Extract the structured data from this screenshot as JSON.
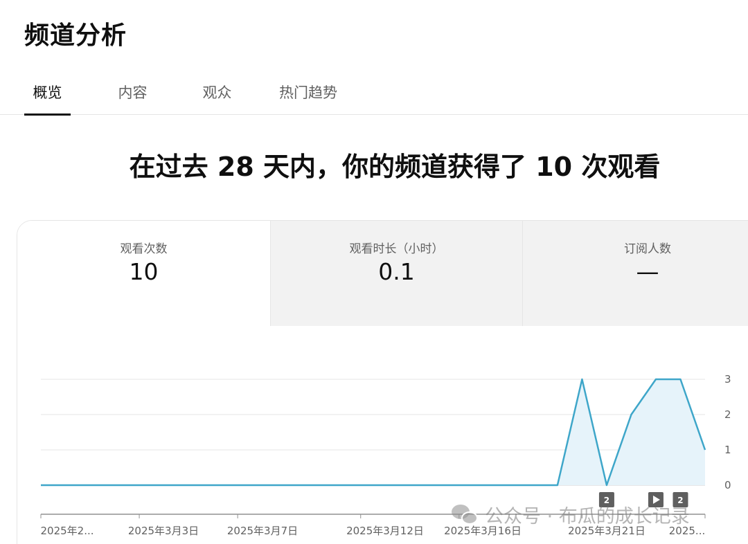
{
  "header": {
    "title": "频道分析"
  },
  "tabs": [
    {
      "label": "概览",
      "active": true
    },
    {
      "label": "内容",
      "active": false
    },
    {
      "label": "观众",
      "active": false
    },
    {
      "label": "热门趋势",
      "active": false
    }
  ],
  "headline": "在过去 28 天内，你的频道获得了 10 次观看",
  "metrics": [
    {
      "label": "观看次数",
      "value": "10"
    },
    {
      "label": "观看时长（小时）",
      "value": "0.1"
    },
    {
      "label": "订阅人数",
      "value": "—"
    }
  ],
  "colors": {
    "line": "#3ea6c9",
    "area": "#e6f3fa",
    "text": "#0f0f0f",
    "muted": "#606060"
  },
  "chart_data": {
    "type": "area",
    "x_tick_labels": [
      "2025年2...",
      "2025年3月3日",
      "2025年3月7日",
      "2025年3月12日",
      "2025年3月16日",
      "2025年3月21日",
      "2025..."
    ],
    "y_ticks": [
      0,
      1,
      2,
      3
    ],
    "ylim": [
      0,
      3
    ],
    "grid": true,
    "series": [
      {
        "values": [
          0,
          0,
          0,
          0,
          0,
          0,
          0,
          0,
          0,
          0,
          0,
          0,
          0,
          0,
          0,
          0,
          0,
          0,
          0,
          0,
          0,
          0,
          3,
          0,
          2,
          3,
          3,
          1
        ]
      }
    ],
    "markers": [
      {
        "label": "2",
        "day_index": 23,
        "type": "number"
      },
      {
        "label": "play",
        "day_index": 25,
        "type": "play-icon"
      },
      {
        "label": "2",
        "day_index": 26,
        "type": "number"
      }
    ]
  },
  "watermark": {
    "text": "公众号 · 布瓜的成长记录",
    "icon": "wechat-icon"
  }
}
